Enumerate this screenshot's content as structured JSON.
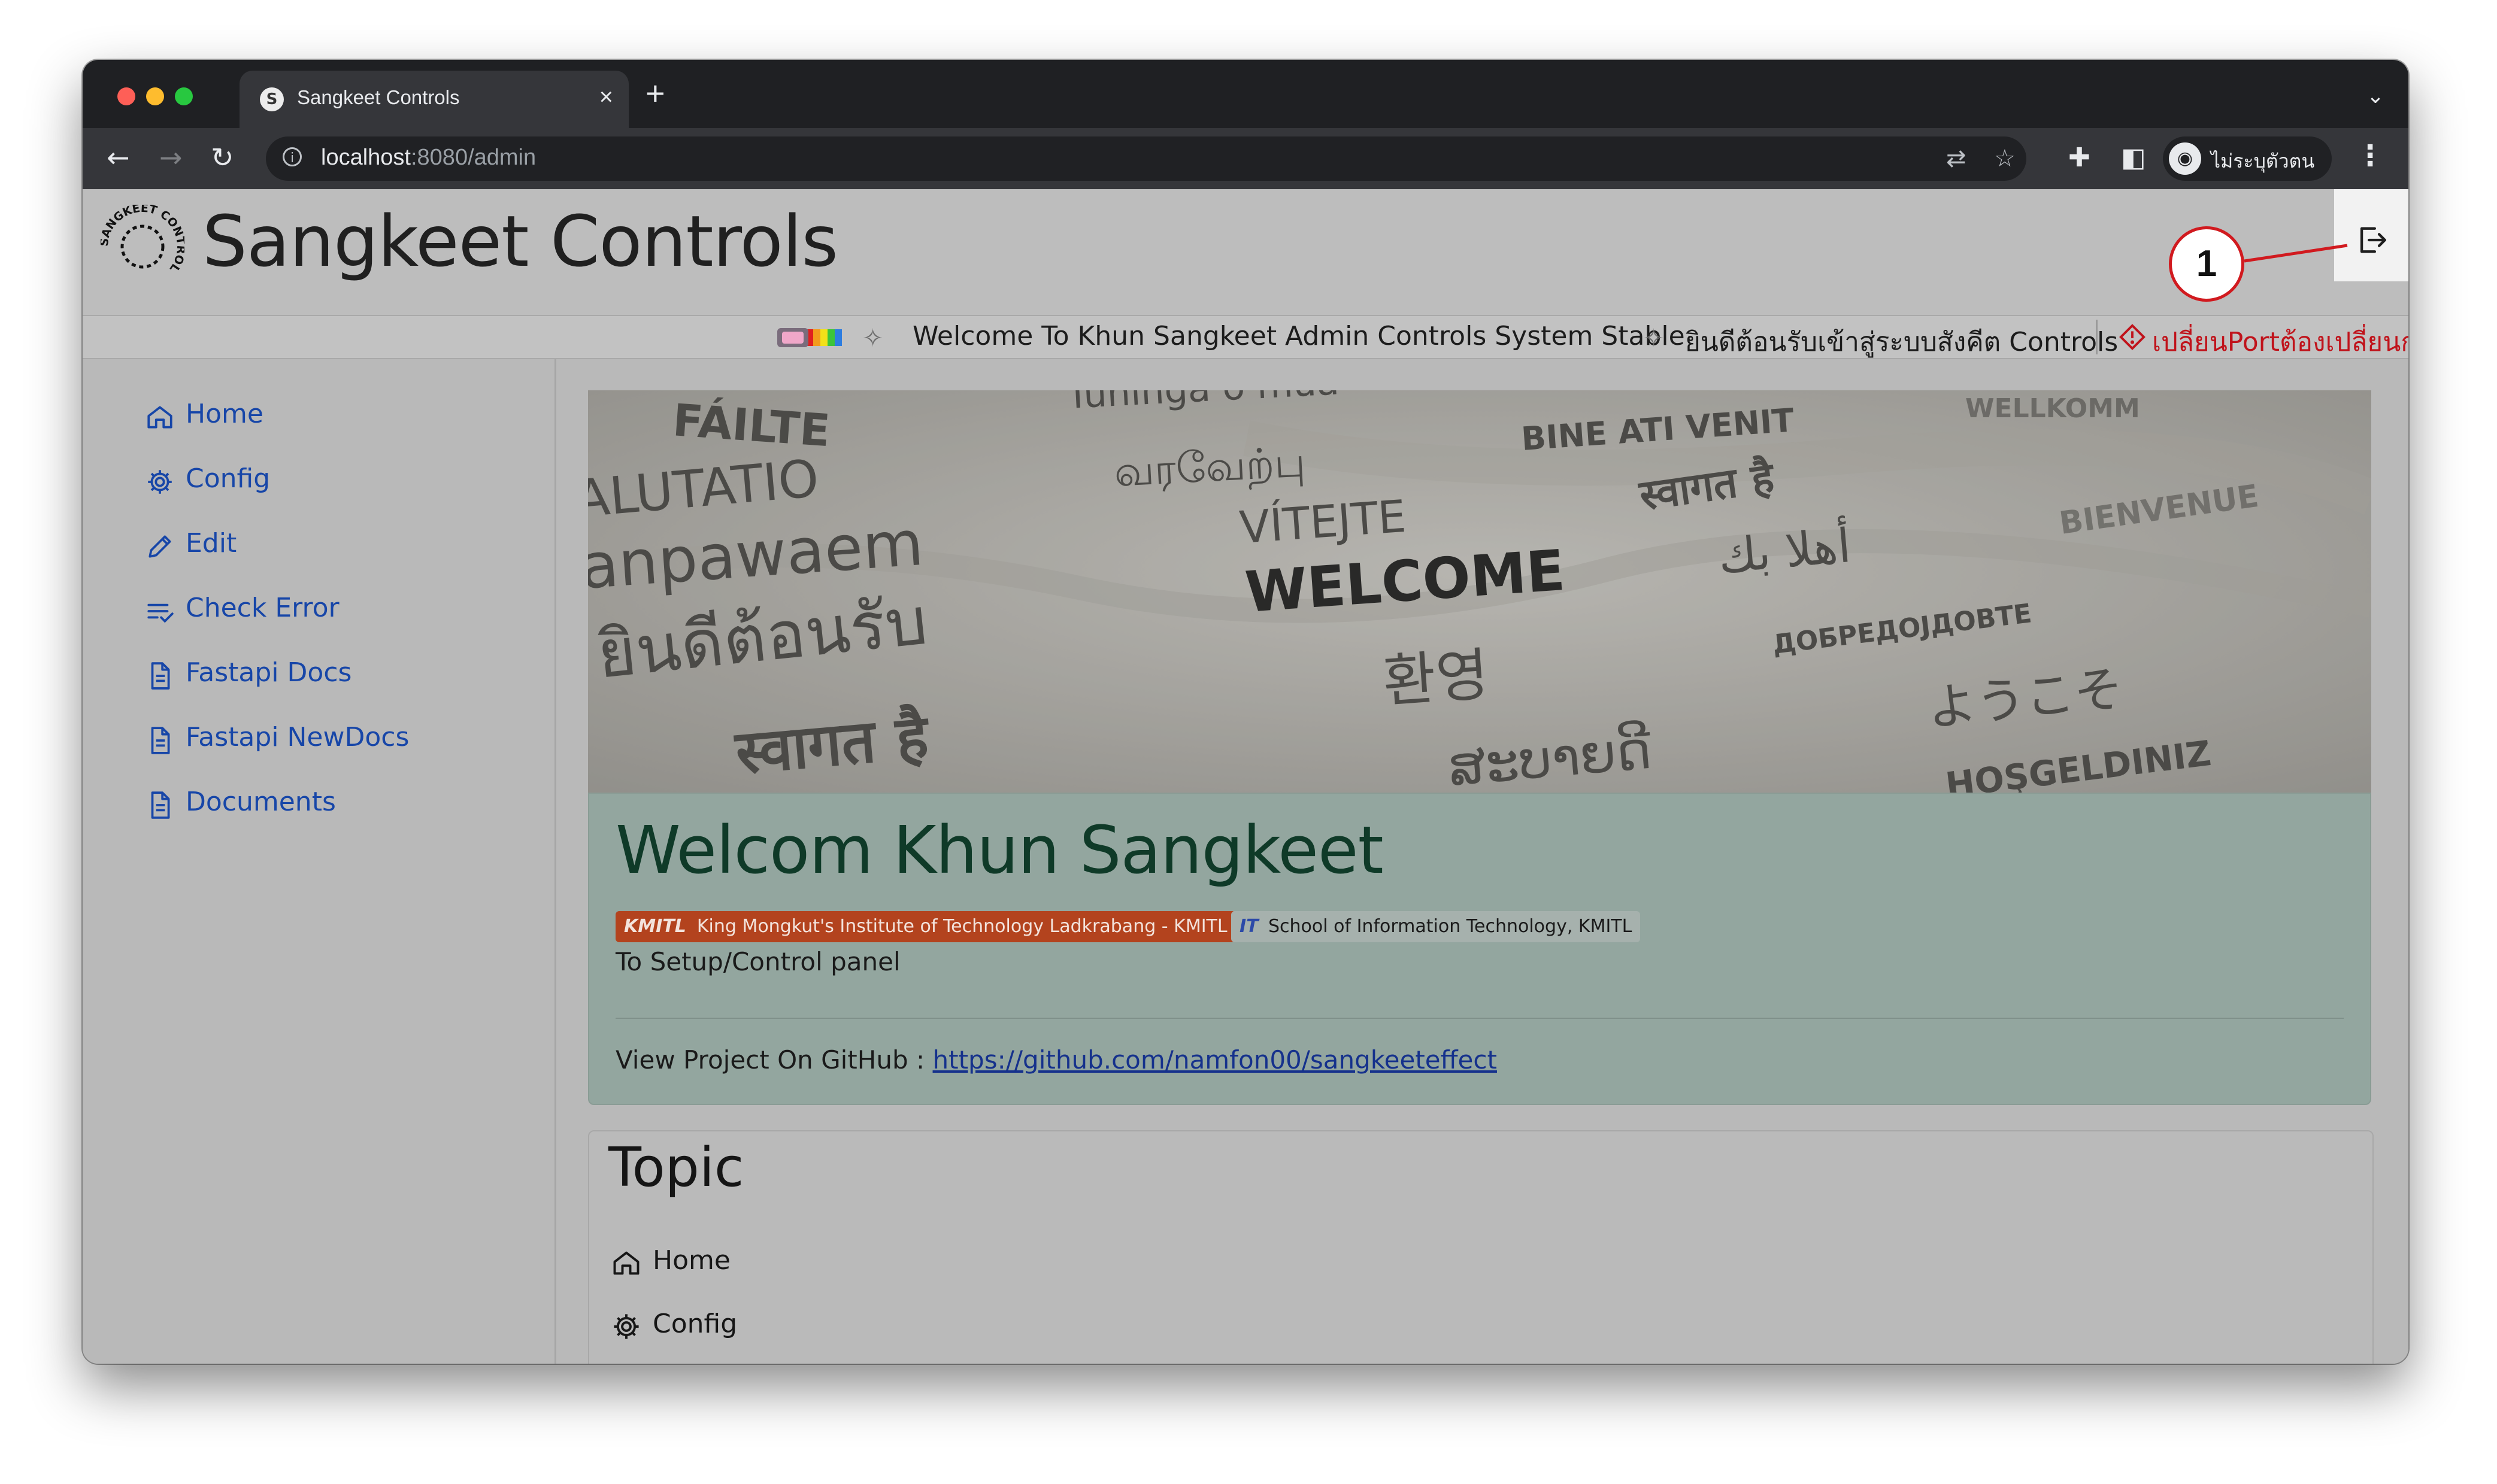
{
  "browser": {
    "tab_title": "Sangkeet Controls",
    "tab_close": "×",
    "new_tab": "+",
    "url_host": "localhost",
    "url_path": ":8080/admin",
    "profile_name": "ไม่ระบุตัวตน"
  },
  "header": {
    "title": "Sangkeet Controls",
    "logo_text": "SANGKEET CONTROL"
  },
  "marquee": {
    "welcome_en": "Welcome To Khun Sangkeet Admin Controls System Stable",
    "welcome_th": "ยินดีต้อนรับเข้าสู่ระบบสังคีต Controls",
    "warning": "เปลี่ยนPortต้องเปลี่ยนก"
  },
  "sidebar": {
    "items": [
      {
        "label": "Home",
        "icon": "home-icon"
      },
      {
        "label": "Config",
        "icon": "gear-icon"
      },
      {
        "label": "Edit",
        "icon": "pencil-icon"
      },
      {
        "label": "Check Error",
        "icon": "list-check-icon"
      },
      {
        "label": "Fastapi Docs",
        "icon": "document-icon"
      },
      {
        "label": "Fastapi NewDocs",
        "icon": "document-icon"
      },
      {
        "label": "Documents",
        "icon": "document-icon"
      }
    ]
  },
  "banner": {
    "words": [
      "FÁILTE",
      "Tuhinga o mua",
      "BINE ATI VENIT",
      "WELLKOMM",
      "ALUTATIO",
      "வரவேற்பு",
      "VÍTEJTE",
      "स्वागत है",
      "BIENVENUE",
      "anpawaem",
      "WELCOME",
      "أهلا بك",
      "ยินดีต้อนรับ",
      "환영",
      "ДОБРЕДОЈДОВТЕ",
      "स्वागत है",
      "ようこそ",
      "ສະບາຍດີ",
      "HOŞGELDINIZ"
    ]
  },
  "card": {
    "title": "Welcom Khun Sangkeet",
    "badge_kmitl_logo": "KMITL",
    "badge_kmitl": "King Mongkut's Institute of Technology Ladkrabang - KMITL",
    "badge_it_logo": "IT",
    "badge_it": "School of Information Technology, KMITL",
    "subtitle": "To Setup/Control panel",
    "github_label": "View Project On GitHub : ",
    "github_link": "https://github.com/namfon00/sangkeeteffect"
  },
  "topic": {
    "title": "Topic",
    "items": [
      {
        "label": "Home",
        "icon": "home-icon"
      },
      {
        "label": "Config",
        "icon": "gear-icon"
      }
    ]
  },
  "annotation": {
    "callout_number": "1"
  },
  "colors": {
    "link_blue": "#1746a8",
    "callout_red": "#d11a1f",
    "card_bg": "#93a69f",
    "warning_red": "#c0131b"
  }
}
